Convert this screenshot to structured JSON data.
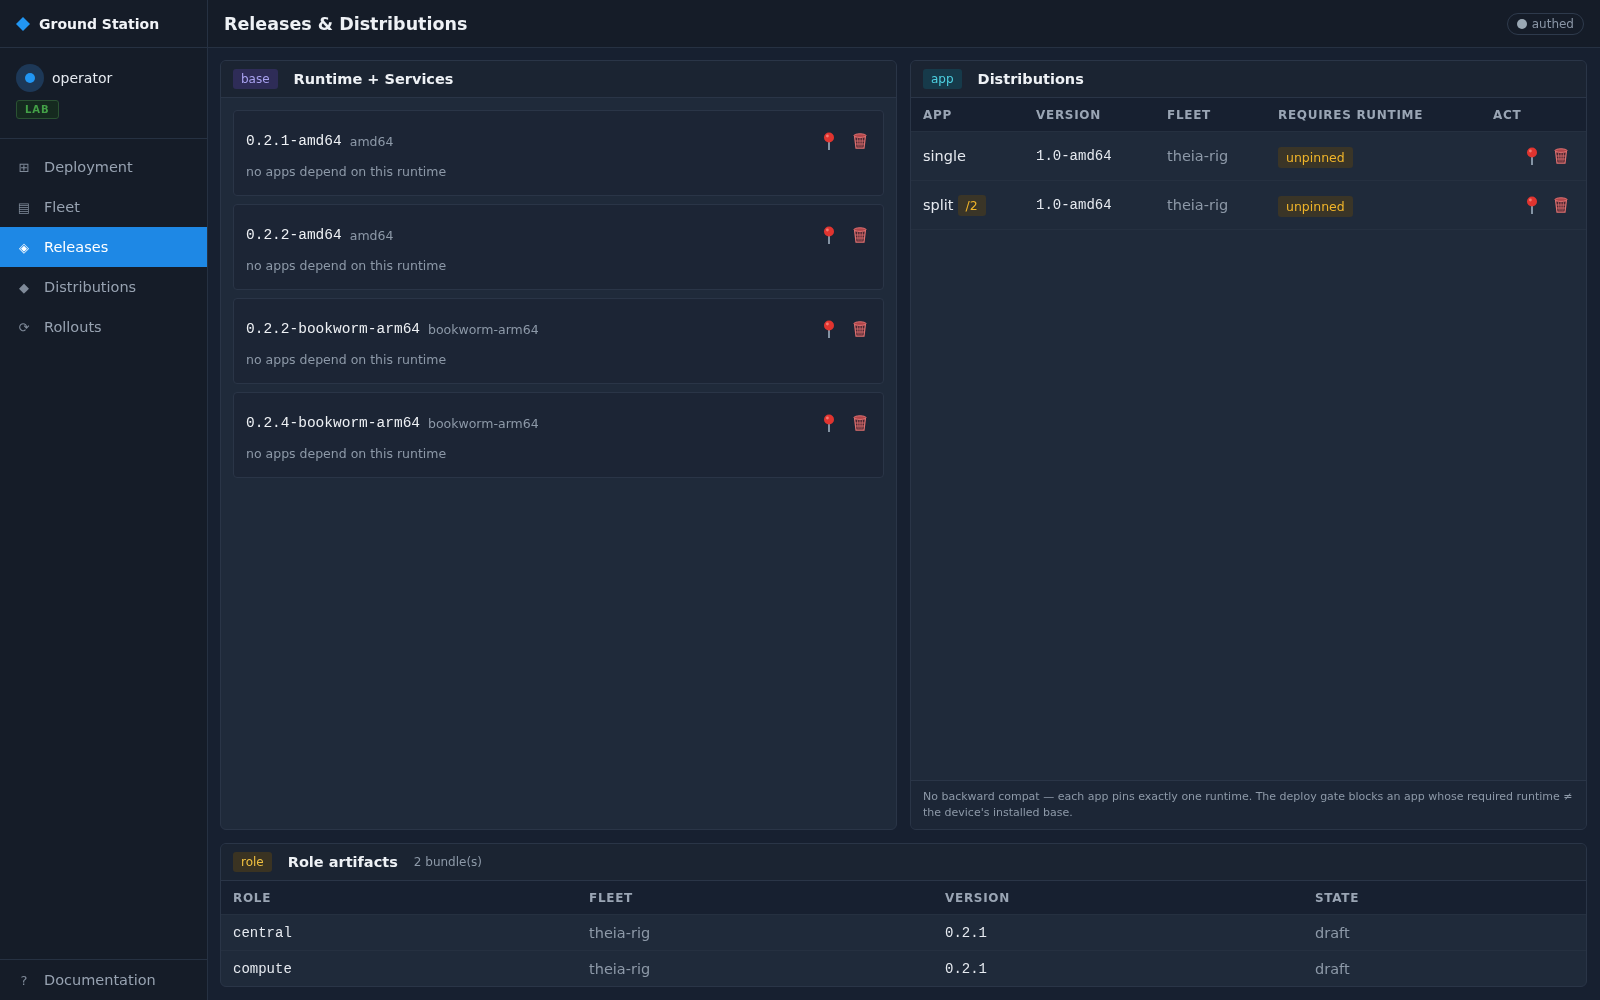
{
  "sidebar": {
    "brand": "Ground Station",
    "user": {
      "name": "operator",
      "badge": "LAB"
    },
    "nav": [
      {
        "icon": "⊞",
        "label": "Deployment",
        "selected": false
      },
      {
        "icon": "▤",
        "label": "Fleet",
        "selected": false
      },
      {
        "icon": "◈",
        "label": "Releases",
        "selected": true
      },
      {
        "icon": "◆",
        "label": "Distributions",
        "selected": false
      },
      {
        "icon": "⟳",
        "label": "Rollouts",
        "selected": false
      }
    ],
    "footer_link": {
      "icon": "?",
      "label": "Documentation"
    }
  },
  "header": {
    "title": "Releases & Distributions",
    "status": "authed"
  },
  "runtime_panel": {
    "tag": "base",
    "title": "Runtime + Services",
    "runtimes": [
      {
        "version": "0.2.1-amd64",
        "arch": "amd64",
        "note": "no apps depend on this runtime"
      },
      {
        "version": "0.2.2-amd64",
        "arch": "amd64",
        "note": "no apps depend on this runtime"
      },
      {
        "version": "0.2.2-bookworm-arm64",
        "arch": "bookworm-arm64",
        "note": "no apps depend on this runtime"
      },
      {
        "version": "0.2.4-bookworm-arm64",
        "arch": "bookworm-arm64",
        "note": "no apps depend on this runtime"
      }
    ]
  },
  "distributions_panel": {
    "tag": "app",
    "title": "Distributions",
    "columns": [
      "APP",
      "VERSION",
      "FLEET",
      "REQUIRES RUNTIME",
      "ACT"
    ],
    "rows": [
      {
        "app": "single",
        "version": "1.0-amd64",
        "fleet": "theia-rig",
        "requires_runtime": "unpinned"
      },
      {
        "app": "split",
        "badge": "/2",
        "version": "1.0-amd64",
        "fleet": "theia-rig",
        "requires_runtime": "unpinned"
      }
    ],
    "note": "No backward compat — each app pins exactly one runtime. The deploy gate blocks an app whose required runtime ≠ the device's installed base."
  },
  "role_panel": {
    "tag": "role",
    "title": "Role artifacts",
    "count": "2 bundle(s)",
    "columns": [
      "ROLE",
      "FLEET",
      "VERSION",
      "STATE"
    ],
    "rows": [
      {
        "role": "central",
        "fleet": "theia-rig",
        "version": "0.2.1",
        "state": "draft"
      },
      {
        "role": "compute",
        "fleet": "theia-rig",
        "version": "0.2.1",
        "state": "draft"
      }
    ]
  }
}
